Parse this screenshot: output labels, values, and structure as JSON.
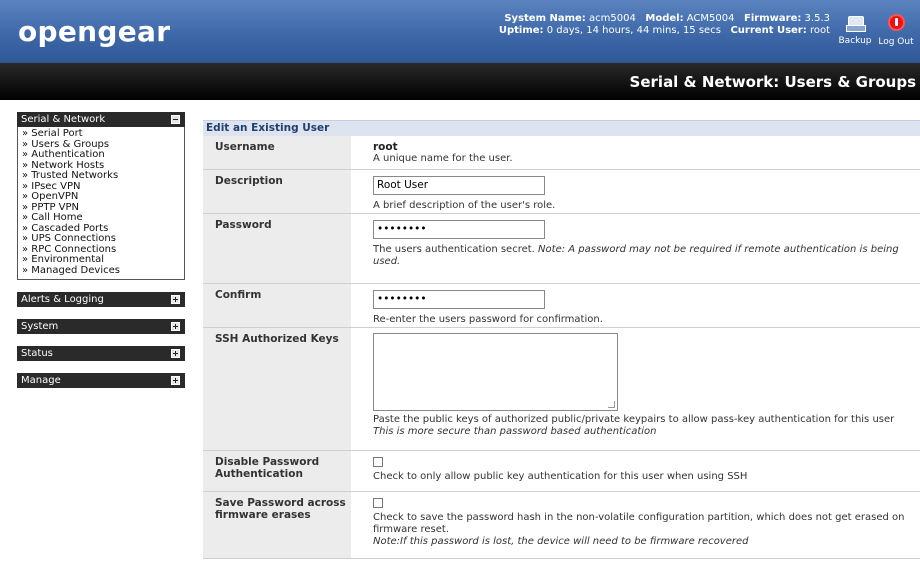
{
  "header": {
    "logo": "opengear",
    "system_name_label": "System Name:",
    "system_name": "acm5004",
    "model_label": "Model:",
    "model": "ACM5004",
    "firmware_label": "Firmware:",
    "firmware": "3.5.3",
    "uptime_label": "Uptime:",
    "uptime": "0 days, 14 hours, 44 mins, 15 secs",
    "current_user_label": "Current User:",
    "current_user": "root",
    "backup_label": "Backup",
    "logout_label": "Log Out"
  },
  "page_title": "Serial & Network: Users & Groups",
  "sidebar": {
    "sections": [
      {
        "title": "Serial & Network",
        "items": [
          "» Serial Port",
          "» Users & Groups",
          "» Authentication",
          "» Network Hosts",
          "» Trusted Networks",
          "» IPsec VPN",
          "» OpenVPN",
          "» PPTP VPN",
          "» Call Home",
          "» Cascaded Ports",
          "» UPS Connections",
          "» RPC Connections",
          "» Environmental",
          "» Managed Devices"
        ]
      },
      {
        "title": "Alerts & Logging"
      },
      {
        "title": "System"
      },
      {
        "title": "Status"
      },
      {
        "title": "Manage"
      }
    ]
  },
  "form": {
    "heading": "Edit an Existing User",
    "username": {
      "label": "Username",
      "value": "root",
      "help": "A unique name for the user."
    },
    "description": {
      "label": "Description",
      "value": "Root User",
      "help": "A brief description of the user's role."
    },
    "password": {
      "label": "Password",
      "value": "••••••••",
      "help": "The users authentication secret. ",
      "note": "Note: A password may not be required if remote authentication is being used."
    },
    "confirm": {
      "label": "Confirm",
      "value": "••••••••",
      "help": "Re-enter the users password for confirmation."
    },
    "ssh_keys": {
      "label": "SSH Authorized Keys",
      "value": "",
      "help": "Paste the public keys of authorized public/private keypairs to allow pass-key authentication for this user",
      "note": "This is more secure than password based authentication"
    },
    "disable_password": {
      "label": "Disable Password Authentication",
      "checked": false,
      "help": "Check to only allow public key authentication for this user when using SSH"
    },
    "save_password": {
      "label": "Save Password across firmware erases",
      "checked": false,
      "help": "Check to save the password hash in the non-volatile configuration partition, which does not get erased on firmware reset.",
      "note": "Note:If this password is lost, the device will need to be firmware recovered"
    }
  }
}
